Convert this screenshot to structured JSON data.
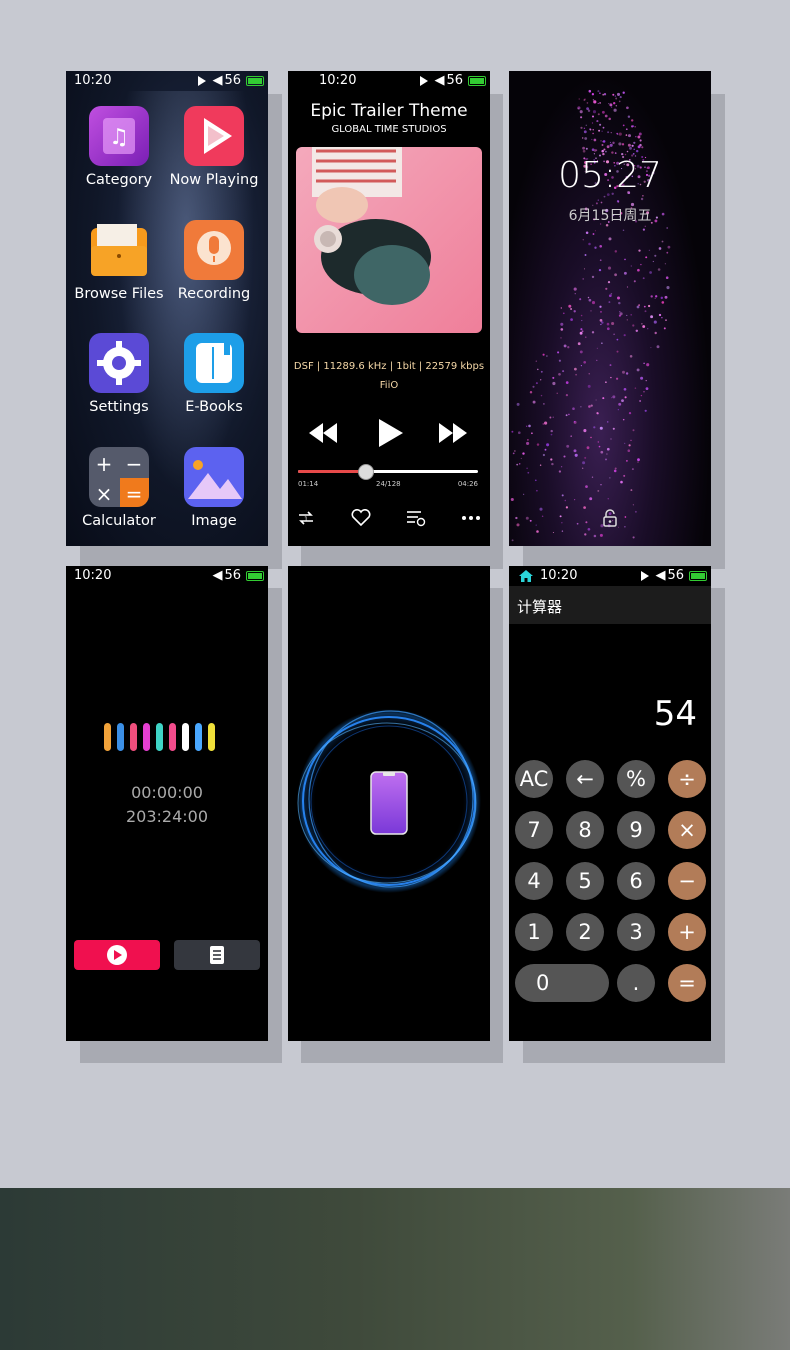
{
  "status": {
    "time": "10:20",
    "volume": "56"
  },
  "home": {
    "apps": [
      {
        "label": "Category"
      },
      {
        "label": "Now Playing"
      },
      {
        "label": "Browse Files"
      },
      {
        "label": "Recording"
      },
      {
        "label": "Settings"
      },
      {
        "label": "E-Books"
      },
      {
        "label": "Calculator"
      },
      {
        "label": "Image"
      }
    ]
  },
  "player": {
    "title": "Epic Trailer Theme",
    "artist": "GLOBAL TIME STUDIOS",
    "format": "DSF | 11289.6 kHz | 1bit | 22579 kbps",
    "brand": "FiiO",
    "elapsed": "01:14",
    "track": "24/128",
    "duration": "04:26",
    "progress": 0.37
  },
  "lock": {
    "clock": "05:27",
    "date": "6月15日周五"
  },
  "recorder": {
    "elapsed": "00:00:00",
    "remaining": "203:24:00",
    "bar_colors": [
      "#f2a33a",
      "#3b8fe6",
      "#ef4e7c",
      "#e63fd2",
      "#3fd4c6",
      "#f24c8c",
      "#ffffff",
      "#4aa8ff",
      "#f0e03a"
    ]
  },
  "calculator": {
    "title": "计算器",
    "display": "54",
    "keys": {
      "ac": "AC",
      "back": "←",
      "percent": "%",
      "divide": "÷",
      "seven": "7",
      "eight": "8",
      "nine": "9",
      "multiply": "×",
      "four": "4",
      "five": "5",
      "six": "6",
      "minus": "−",
      "one": "1",
      "two": "2",
      "three": "3",
      "plus": "+",
      "zero": "0",
      "dot": ".",
      "equals": "="
    }
  },
  "colors": {
    "accent_red": "#f0104f",
    "calc_op": "#b27c58",
    "battery": "#33cc33",
    "home": "#2bd4d8"
  }
}
